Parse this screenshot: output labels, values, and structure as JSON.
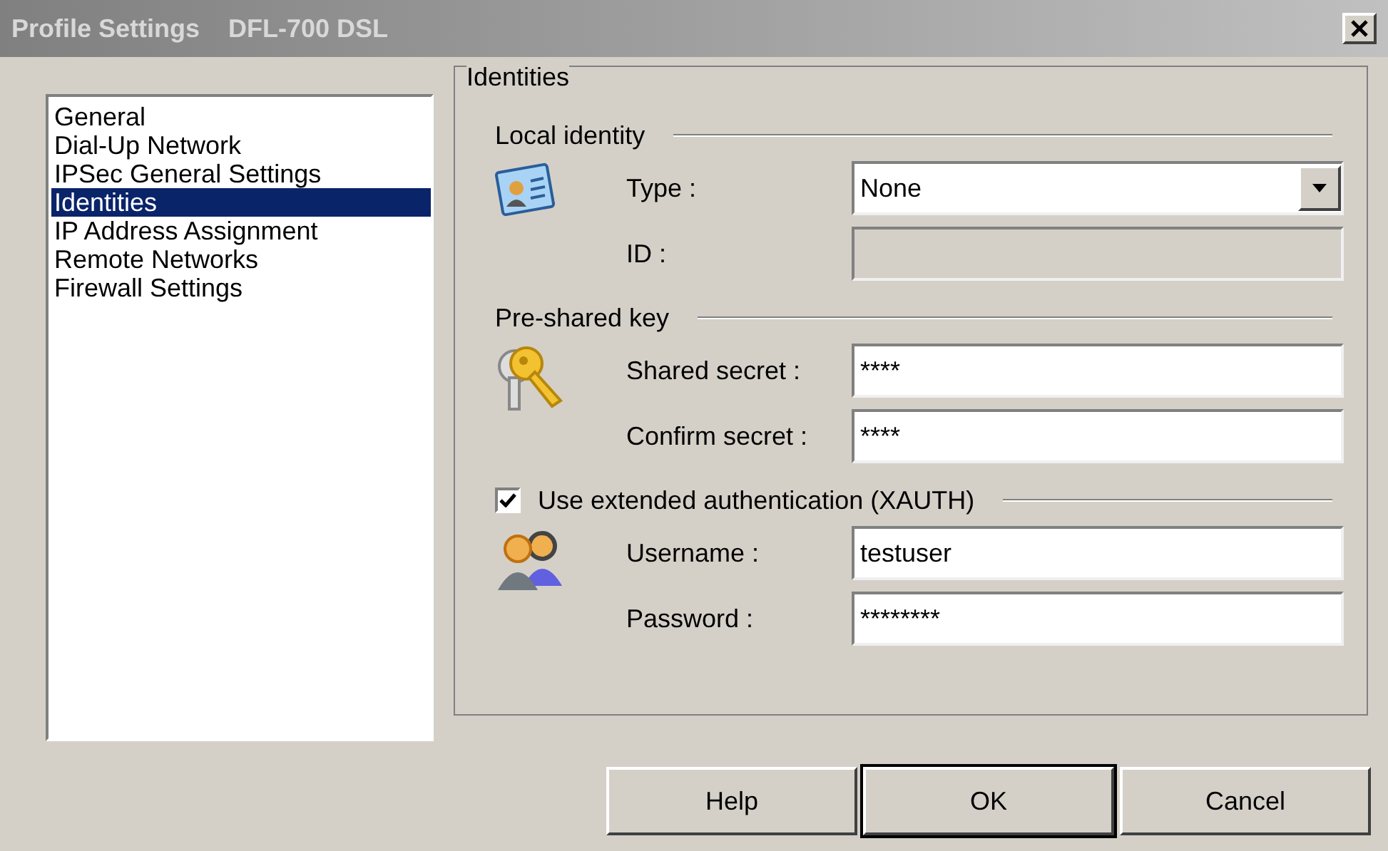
{
  "window": {
    "title": "Profile Settings",
    "subtitle": "DFL-700 DSL"
  },
  "sidebar": {
    "items": [
      {
        "label": "General",
        "selected": false
      },
      {
        "label": "Dial-Up Network",
        "selected": false
      },
      {
        "label": "IPSec General Settings",
        "selected": false
      },
      {
        "label": "Identities",
        "selected": true
      },
      {
        "label": "IP Address Assignment",
        "selected": false
      },
      {
        "label": "Remote Networks",
        "selected": false
      },
      {
        "label": "Firewall Settings",
        "selected": false
      }
    ]
  },
  "panel": {
    "title": "Identities",
    "sections": [
      {
        "title": "Local identity",
        "fields": [
          {
            "label": "Type :",
            "kind": "dropdown",
            "value": "None",
            "disabled": false
          },
          {
            "label": "ID :",
            "kind": "text",
            "disabled": true
          }
        ]
      },
      {
        "title": "Pre-shared key",
        "fields": [
          {
            "label": "Shared secret :",
            "kind": "text",
            "value": "****",
            "disabled": false
          },
          {
            "label": "Confirm secret :",
            "kind": "text",
            "value": "****",
            "disabled": false
          }
        ]
      },
      {
        "title": "Use extended authentication (XAUTH)",
        "checked": true,
        "fields": [
          {
            "label": "Username :",
            "kind": "text",
            "value": "testuser",
            "disabled": false
          },
          {
            "label": "Password :",
            "kind": "text",
            "value": "********",
            "disabled": false
          }
        ]
      }
    ]
  },
  "buttons": [
    {
      "label": "Help",
      "default": false
    },
    {
      "label": "OK",
      "default": true
    },
    {
      "label": "Cancel",
      "default": false
    }
  ]
}
